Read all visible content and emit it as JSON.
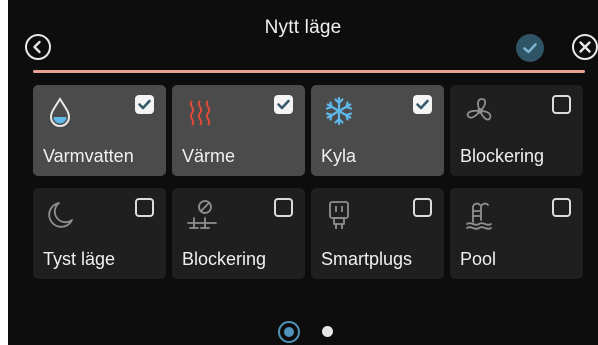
{
  "header": {
    "title": "Nytt läge",
    "back_icon": "chevron-left-circle-icon",
    "confirm_icon": "check-circle-icon",
    "close_icon": "close-circle-icon"
  },
  "colors": {
    "divider": "#e6a394",
    "tile_active": "#4b4b4b",
    "tile_inactive": "#1f1f1f",
    "accent_blue": "#4f93b8",
    "heat_red": "#e04a3a",
    "cool_blue": "#5fb8ea"
  },
  "tiles": [
    {
      "label": "Varmvatten",
      "icon": "water-drop-icon",
      "checked": true
    },
    {
      "label": "Värme",
      "icon": "heat-waves-icon",
      "checked": true
    },
    {
      "label": "Kyla",
      "icon": "snowflake-icon",
      "checked": true
    },
    {
      "label": "Blockering",
      "icon": "fan-icon",
      "checked": false
    },
    {
      "label": "Tyst läge",
      "icon": "moon-icon",
      "checked": false
    },
    {
      "label": "Blockering",
      "icon": "compressor-block-icon",
      "checked": false
    },
    {
      "label": "Smartplugs",
      "icon": "plug-icon",
      "checked": false
    },
    {
      "label": "Pool",
      "icon": "pool-ladder-icon",
      "checked": false
    }
  ],
  "pager": {
    "current_page": 1,
    "total_pages": 2
  }
}
